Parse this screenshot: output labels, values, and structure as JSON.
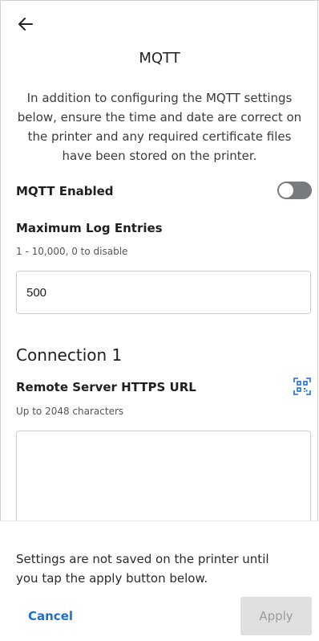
{
  "header": {
    "back_icon": "arrow-left-icon",
    "title": "MQTT"
  },
  "intro": "In addition to configuring the MQTT settings below, ensure the time and date are correct on the printer and any required certificate files have been stored on the printer.",
  "mqtt_enabled": {
    "label": "MQTT Enabled",
    "state": "off"
  },
  "max_log": {
    "label": "Maximum Log Entries",
    "hint": "1 - 10,000, 0 to disable",
    "value": "500"
  },
  "connection": {
    "title": "Connection 1",
    "url_label": "Remote Server HTTPS URL",
    "url_hint": "Up to 2048 characters",
    "url_value": "",
    "qr_icon": "qr-scan-icon"
  },
  "footer": {
    "message": "Settings are not saved on the printer until you tap the apply button below.",
    "cancel": "Cancel",
    "apply": "Apply"
  },
  "colors": {
    "accent": "#1e6fd0",
    "toggle_off": "#777b80",
    "disabled_bg": "#e0e0e0"
  }
}
